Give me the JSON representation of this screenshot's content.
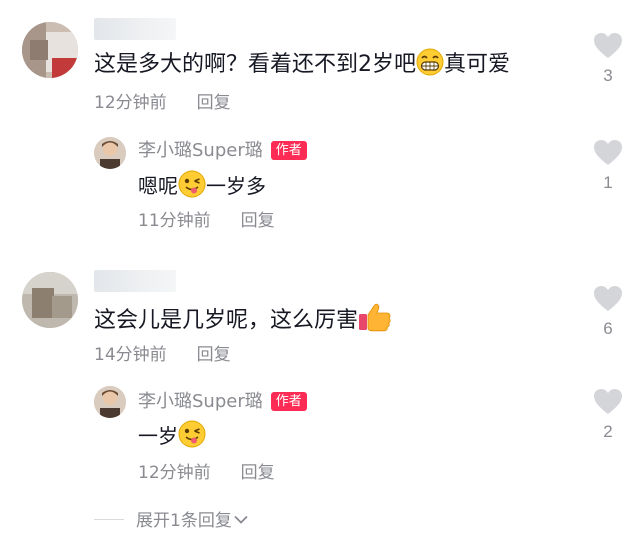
{
  "comments": [
    {
      "text": "这是多大的啊？看着还不到2岁吧",
      "text_suffix": "真可爱",
      "time": "12分钟前",
      "reply_label": "回复",
      "likes": "3",
      "reply": {
        "author": "李小璐Super璐",
        "badge": "作者",
        "text_before": "嗯呢",
        "text_after": "一岁多",
        "time": "11分钟前",
        "reply_label": "回复",
        "likes": "1"
      }
    },
    {
      "text": "这会儿是几岁呢，这么厉害",
      "time": "14分钟前",
      "reply_label": "回复",
      "likes": "6",
      "reply": {
        "author": "李小璐Super璐",
        "badge": "作者",
        "text_before": "一岁",
        "time": "12分钟前",
        "reply_label": "回复",
        "likes": "2"
      },
      "expand_label": "展开1条回复"
    }
  ],
  "colors": {
    "badge": "#fe2c55",
    "meta": "#8a8b91",
    "heart": "#d4d5d8"
  }
}
